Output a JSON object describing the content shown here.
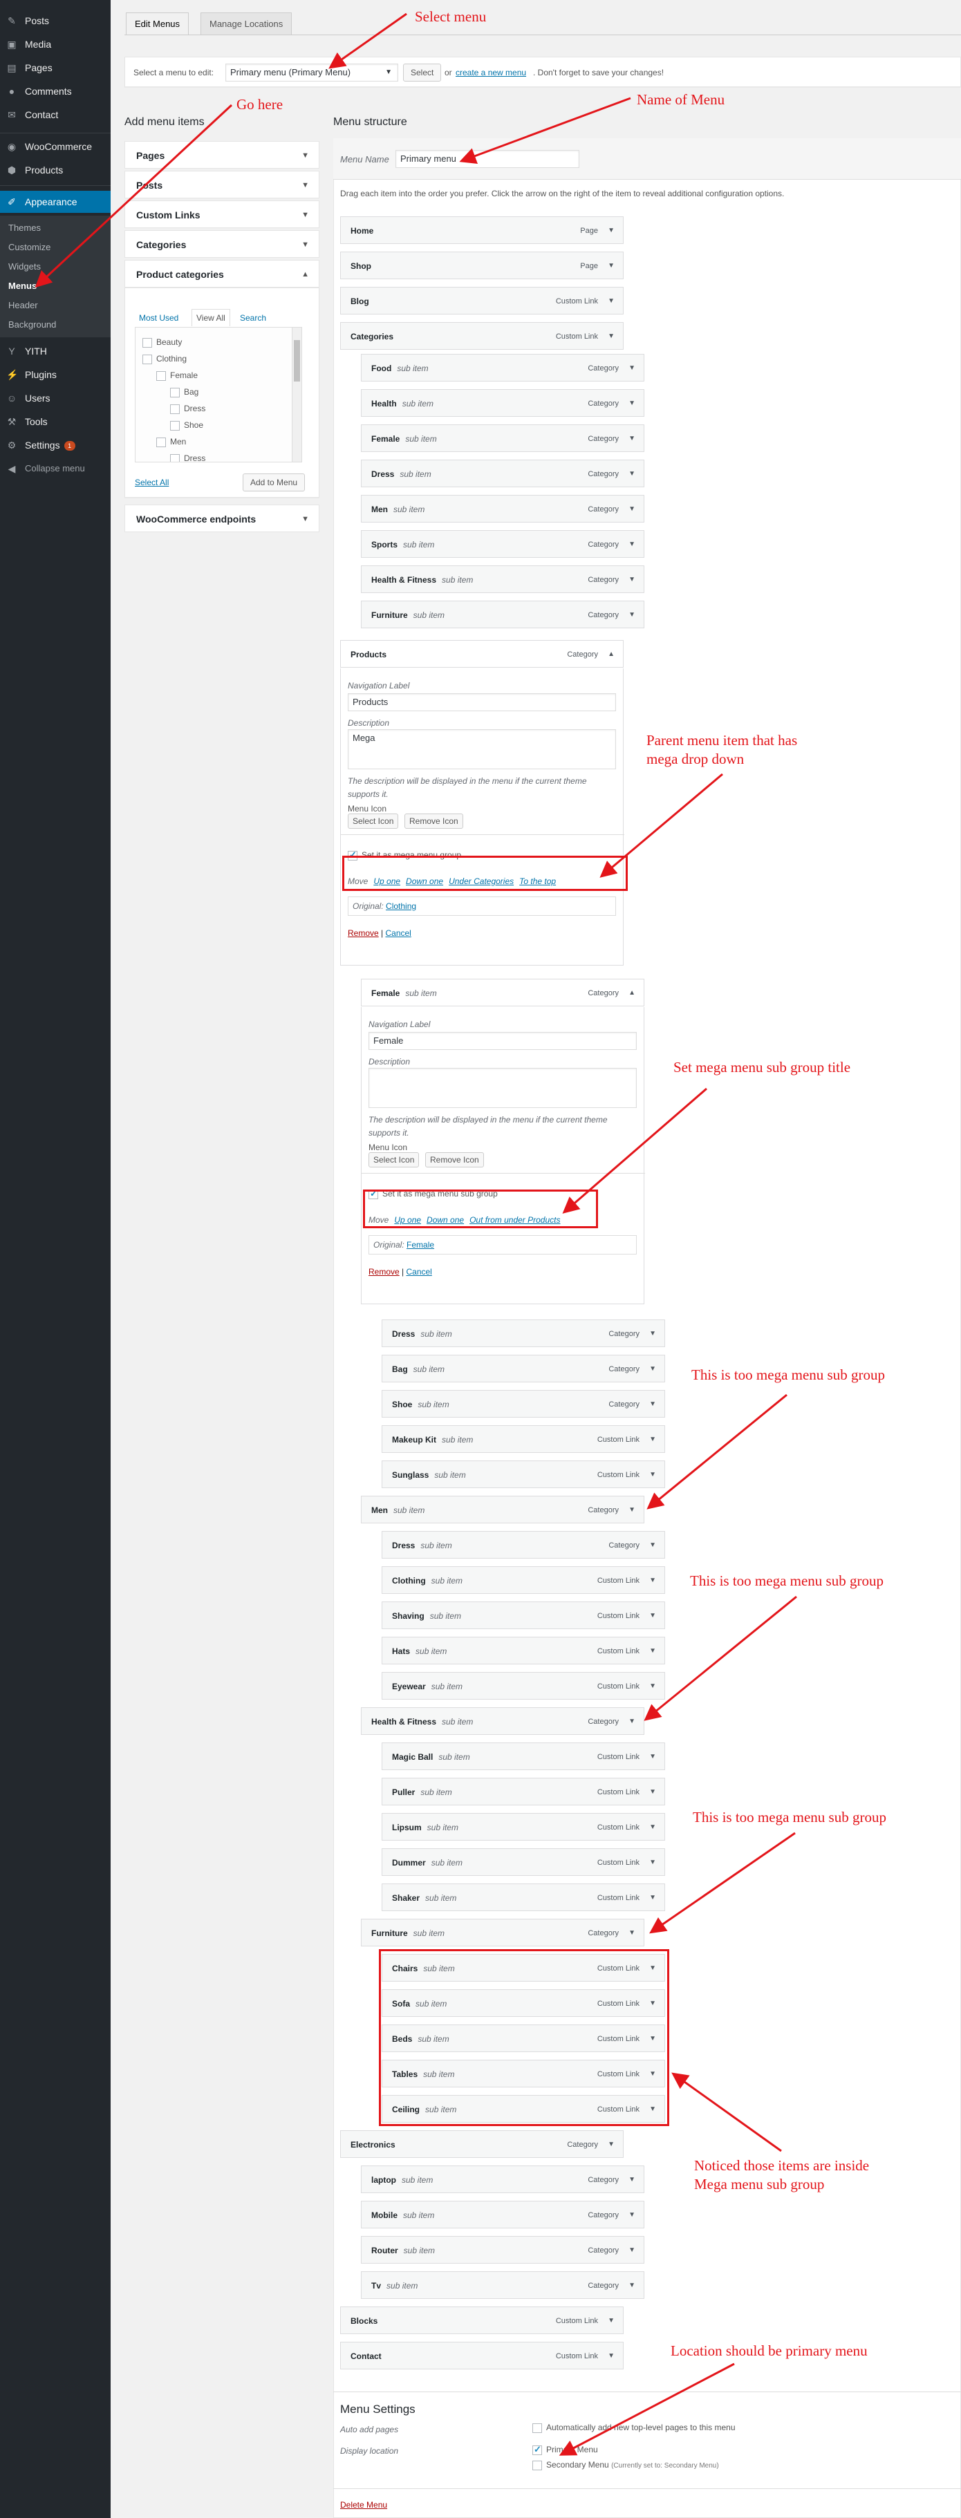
{
  "sidebar": {
    "items": [
      {
        "label": "Posts",
        "icon": "pin-icon"
      },
      {
        "label": "Media",
        "icon": "media-icon"
      },
      {
        "label": "Pages",
        "icon": "pages-icon"
      },
      {
        "label": "Comments",
        "icon": "comments-icon"
      },
      {
        "label": "Contact",
        "icon": "mail-icon"
      },
      {
        "label": "WooCommerce",
        "icon": "woo-icon"
      },
      {
        "label": "Products",
        "icon": "products-icon"
      },
      {
        "label": "Appearance",
        "icon": "appearance-icon"
      },
      {
        "label": "YITH",
        "icon": "yith-icon"
      },
      {
        "label": "Plugins",
        "icon": "plugins-icon"
      },
      {
        "label": "Users",
        "icon": "users-icon"
      },
      {
        "label": "Tools",
        "icon": "tools-icon"
      },
      {
        "label": "Settings",
        "icon": "settings-icon",
        "badge": "1"
      },
      {
        "label": "Collapse menu",
        "icon": "collapse-icon"
      }
    ],
    "appearance_sub": [
      "Themes",
      "Customize",
      "Widgets",
      "Menus",
      "Header",
      "Background"
    ]
  },
  "tabs": {
    "edit": "Edit Menus",
    "locations": "Manage Locations"
  },
  "select_bar": {
    "prefix": "Select a menu to edit:",
    "value": "Primary menu (Primary Menu)",
    "select_btn": "Select",
    "or": "or",
    "create_link": "create a new menu",
    "suffix": ". Don't forget to save your changes!"
  },
  "add_items": {
    "title": "Add menu items",
    "sections": [
      "Pages",
      "Posts",
      "Custom Links",
      "Categories",
      "Product categories"
    ],
    "subtabs": [
      "Most Used",
      "View All",
      "Search"
    ],
    "categories": [
      "Beauty",
      "Clothing",
      "Female",
      "Bag",
      "Dress",
      "Shoe",
      "Men",
      "Dress"
    ],
    "select_all": "Select All",
    "add_btn": "Add to Menu",
    "woo_endpoints": "WooCommerce endpoints"
  },
  "structure": {
    "title": "Menu structure",
    "name_label": "Menu Name",
    "name_value": "Primary menu",
    "instructions": "Drag each item into the order you prefer. Click the arrow on the right of the item to reveal additional configuration options.",
    "sub_item": "sub item",
    "top": [
      {
        "title": "Home",
        "type": "Page"
      },
      {
        "title": "Shop",
        "type": "Page"
      },
      {
        "title": "Blog",
        "type": "Custom Link"
      },
      {
        "title": "Categories",
        "type": "Custom Link"
      }
    ],
    "cat_children": [
      {
        "title": "Food",
        "type": "Category"
      },
      {
        "title": "Health",
        "type": "Category"
      },
      {
        "title": "Female",
        "type": "Category"
      },
      {
        "title": "Dress",
        "type": "Category"
      },
      {
        "title": "Men",
        "type": "Category"
      },
      {
        "title": "Sports",
        "type": "Category"
      },
      {
        "title": "Health & Fitness",
        "type": "Category"
      },
      {
        "title": "Furniture",
        "type": "Category"
      }
    ],
    "products": {
      "title": "Products",
      "type": "Category",
      "nav_label": "Navigation Label",
      "nav_value": "Products",
      "desc_label": "Description",
      "desc_value": "Mega",
      "help": "The description will be displayed in the menu if the current theme supports it.",
      "icon_label": "Menu Icon",
      "select_icon": "Select Icon",
      "remove_icon": "Remove Icon",
      "mega_label": "Set it as mega menu group",
      "move_label": "Move",
      "moves": [
        "Up one",
        "Down one",
        "Under Categories",
        "To the top"
      ],
      "original_label": "Original:",
      "original_value": "Clothing",
      "remove": "Remove",
      "cancel": "Cancel"
    },
    "female": {
      "title": "Female",
      "type": "Category",
      "nav_label": "Navigation Label",
      "nav_value": "Female",
      "desc_label": "Description",
      "help": "The description will be displayed in the menu if the current theme supports it.",
      "icon_label": "Menu Icon",
      "select_icon": "Select Icon",
      "remove_icon": "Remove Icon",
      "mega_label": "Set it as mega menu sub group",
      "move_label": "Move",
      "moves": [
        "Up one",
        "Down one",
        "Out from under Products"
      ],
      "original_label": "Original:",
      "original_value": "Female",
      "remove": "Remove",
      "cancel": "Cancel"
    },
    "female_children": [
      {
        "title": "Dress",
        "type": "Category"
      },
      {
        "title": "Bag",
        "type": "Category"
      },
      {
        "title": "Shoe",
        "type": "Category"
      },
      {
        "title": "Makeup Kit",
        "type": "Custom Link"
      },
      {
        "title": "Sunglass",
        "type": "Custom Link"
      }
    ],
    "men": {
      "title": "Men",
      "type": "Category"
    },
    "men_children": [
      {
        "title": "Dress",
        "type": "Category"
      },
      {
        "title": "Clothing",
        "type": "Custom Link"
      },
      {
        "title": "Shaving",
        "type": "Custom Link"
      },
      {
        "title": "Hats",
        "type": "Custom Link"
      },
      {
        "title": "Eyewear",
        "type": "Custom Link"
      }
    ],
    "hf": {
      "title": "Health & Fitness",
      "type": "Category"
    },
    "hf_children": [
      {
        "title": "Magic Ball",
        "type": "Custom Link"
      },
      {
        "title": "Puller",
        "type": "Custom Link"
      },
      {
        "title": "Lipsum",
        "type": "Custom Link"
      },
      {
        "title": "Dummer",
        "type": "Custom Link"
      },
      {
        "title": "Shaker",
        "type": "Custom Link"
      }
    ],
    "furn": {
      "title": "Furniture",
      "type": "Category"
    },
    "furn_children": [
      {
        "title": "Chairs",
        "type": "Custom Link"
      },
      {
        "title": "Sofa",
        "type": "Custom Link"
      },
      {
        "title": "Beds",
        "type": "Custom Link"
      },
      {
        "title": "Tables",
        "type": "Custom Link"
      },
      {
        "title": "Ceiling",
        "type": "Custom Link"
      }
    ],
    "electronics": {
      "title": "Electronics",
      "type": "Category"
    },
    "elec_children": [
      {
        "title": "laptop",
        "type": "Category"
      },
      {
        "title": "Mobile",
        "type": "Category"
      },
      {
        "title": "Router",
        "type": "Category"
      },
      {
        "title": "Tv",
        "type": "Category"
      }
    ],
    "bottom": [
      {
        "title": "Blocks",
        "type": "Custom Link"
      },
      {
        "title": "Contact",
        "type": "Custom Link"
      }
    ]
  },
  "settings": {
    "title": "Menu Settings",
    "auto_label": "Auto add pages",
    "auto_text": "Automatically add new top-level pages to this menu",
    "display_label": "Display location",
    "primary": "Primary Menu",
    "secondary": "Secondary Menu",
    "secondary_note": "(Currently set to: Secondary Menu)",
    "delete": "Delete Menu"
  },
  "annotations": {
    "select_menu": "Select menu",
    "go_here": "Go here",
    "name_of_menu": "Name of Menu",
    "parent_mega": [
      "Parent menu item that has",
      "mega drop down"
    ],
    "set_sub_title": "Set mega menu sub group title",
    "too_sub_1": "This is too mega menu sub group",
    "too_sub_2": "This is too mega menu sub group",
    "too_sub_3": "This is too mega menu sub group",
    "noticed": [
      "Noticed those items are inside",
      "Mega menu sub group"
    ],
    "location": "Location should be primary menu"
  },
  "colors": {
    "annotation": "#e3151a",
    "sidebar": "#23282d",
    "accent": "#0073aa"
  }
}
